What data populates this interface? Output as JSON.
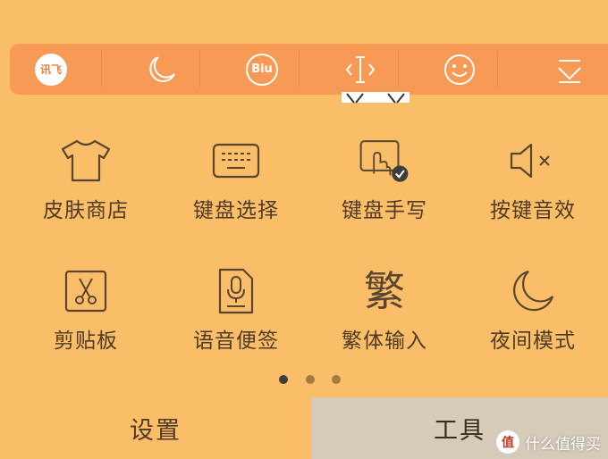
{
  "toolbar": {
    "items": [
      {
        "name": "iflytek-logo",
        "text": "讯飞"
      },
      {
        "name": "moon",
        "text": ""
      },
      {
        "name": "biu",
        "text": "Biu"
      },
      {
        "name": "cursor-move",
        "text": ""
      },
      {
        "name": "smiley",
        "text": ""
      },
      {
        "name": "collapse-keyboard",
        "text": ""
      }
    ]
  },
  "grid": {
    "items": [
      {
        "label": "皮肤商店",
        "icon": "tshirt-icon"
      },
      {
        "label": "键盘选择",
        "icon": "keyboard-icon"
      },
      {
        "label": "键盘手写",
        "icon": "handwriting-icon"
      },
      {
        "label": "按键音效",
        "icon": "sound-mute-icon"
      },
      {
        "label": "剪贴板",
        "icon": "scissors-icon"
      },
      {
        "label": "语音便签",
        "icon": "voice-note-icon"
      },
      {
        "label": "繁体输入",
        "icon": "traditional-chinese-icon",
        "glyph": "繁"
      },
      {
        "label": "夜间模式",
        "icon": "moon-icon"
      }
    ]
  },
  "pager": {
    "count": 3,
    "active": 0
  },
  "tabs": {
    "settings": "设置",
    "tools": "工具",
    "active": "tools"
  },
  "watermark": {
    "logo": "值",
    "text": "什么值得买"
  },
  "colors": {
    "background": "#FABE68",
    "toolbar": "#F79A56",
    "tools_tab": "#D6CAB8",
    "icon_stroke": "#5a4630",
    "dot_active": "#3d3d3d",
    "dot_inactive": "#a57a3e"
  }
}
